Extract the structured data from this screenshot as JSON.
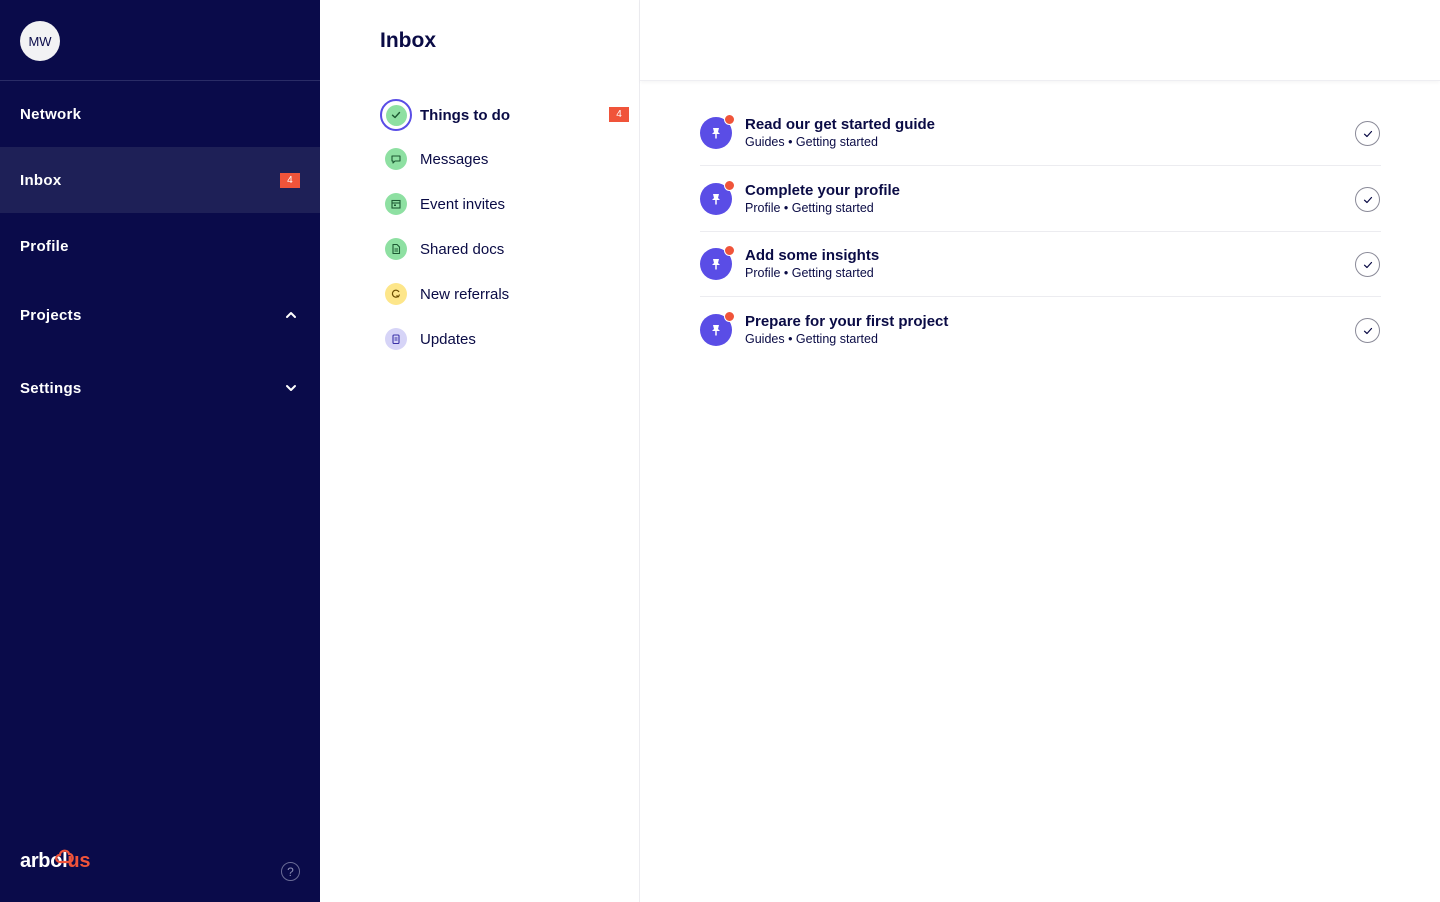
{
  "user": {
    "initials": "MW"
  },
  "sidebar": {
    "items": [
      {
        "label": "Network"
      },
      {
        "label": "Inbox",
        "badge": "4"
      },
      {
        "label": "Profile"
      },
      {
        "label": "Projects",
        "chevron": "chevron-up-icon"
      },
      {
        "label": "Settings",
        "chevron": "chevron-down-icon"
      }
    ],
    "logo": {
      "part1": "arbol",
      "part2": "us"
    },
    "help": "?"
  },
  "inbox": {
    "title": "Inbox",
    "categories": [
      {
        "label": "Things to do",
        "badge": "4",
        "icon": "check-icon",
        "color": "#8ee0a2"
      },
      {
        "label": "Messages",
        "icon": "chat-icon",
        "color": "#8ee0a2"
      },
      {
        "label": "Event invites",
        "icon": "calendar-icon",
        "color": "#8ee0a2"
      },
      {
        "label": "Shared docs",
        "icon": "document-icon",
        "color": "#8ee0a2"
      },
      {
        "label": "New referrals",
        "icon": "referral-icon",
        "color": "#fde68a"
      },
      {
        "label": "Updates",
        "icon": "clipboard-icon",
        "color": "#d6d4f7"
      }
    ]
  },
  "tasks": [
    {
      "title": "Read our get started guide",
      "meta": "Guides • Getting started"
    },
    {
      "title": "Complete your profile",
      "meta": "Profile • Getting started"
    },
    {
      "title": "Add some insights",
      "meta": "Profile • Getting started"
    },
    {
      "title": "Prepare for your first project",
      "meta": "Guides • Getting started"
    }
  ],
  "colors": {
    "sidebar_bg": "#0a0b4a",
    "accent_purple": "#5a4de6",
    "badge_red": "#f0543a",
    "green": "#8ee0a2"
  }
}
